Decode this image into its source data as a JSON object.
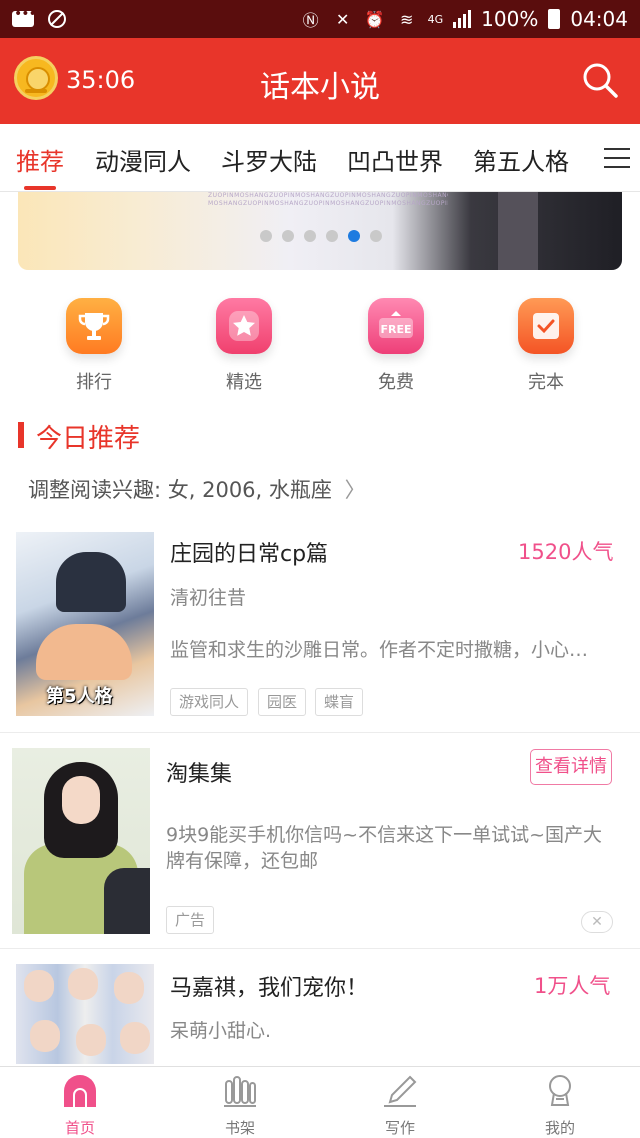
{
  "status_bar": {
    "network": "4G",
    "battery": "100%",
    "time": "04:04"
  },
  "header": {
    "timer": "35:06",
    "title": "话本小说"
  },
  "tabs": [
    "推荐",
    "动漫同人",
    "斗罗大陆",
    "凹凸世界",
    "第五人格"
  ],
  "banner": {
    "watermark": "ZUOPINMOSHANGZUOPINMOSHANGZUOPINMOSHANGZUOPINMOSHANGZUOPIN MOSHANGZUOPINMOSHANGZUOPINMOSHANGZUOPINMOSHANGZUOPIN",
    "dot_count": 6,
    "active_dot": 4
  },
  "quick_entries": [
    {
      "label": "排行",
      "icon": "trophy-icon"
    },
    {
      "label": "精选",
      "icon": "star-icon"
    },
    {
      "label": "免费",
      "icon": "free-badge-icon",
      "badge_text": "FREE"
    },
    {
      "label": "完本",
      "icon": "checkmark-icon"
    }
  ],
  "section": {
    "title": "今日推荐",
    "interest": "调整阅读兴趣: 女, 2006, 水瓶座"
  },
  "books": [
    {
      "title": "庄园的日常cp篇",
      "popularity": "1520人气",
      "author": "清初往昔",
      "description": "监管和求生的沙雕日常。作者不定时撒糖，小心…",
      "tags": [
        "游戏同人",
        "园医",
        "蝶盲"
      ],
      "cover_text": "第5人格"
    },
    {
      "title": "淘集集",
      "action": "查看详情",
      "description": "9块9能买手机你信吗~不信来这下一单试试~国产大牌有保障，还包邮",
      "tag": "广告",
      "close": "✕"
    },
    {
      "title": "马嘉祺，我们宠你！",
      "popularity": "1万人气",
      "author": "呆萌小甜心."
    }
  ],
  "bottom_nav": [
    {
      "label": "首页",
      "active": true
    },
    {
      "label": "书架",
      "active": false
    },
    {
      "label": "写作",
      "active": false
    },
    {
      "label": "我的",
      "active": false
    }
  ],
  "colors": {
    "primary_red": "#e8352a",
    "pink_accent": "#f0508a",
    "status_bar": "#5a0d0d"
  }
}
